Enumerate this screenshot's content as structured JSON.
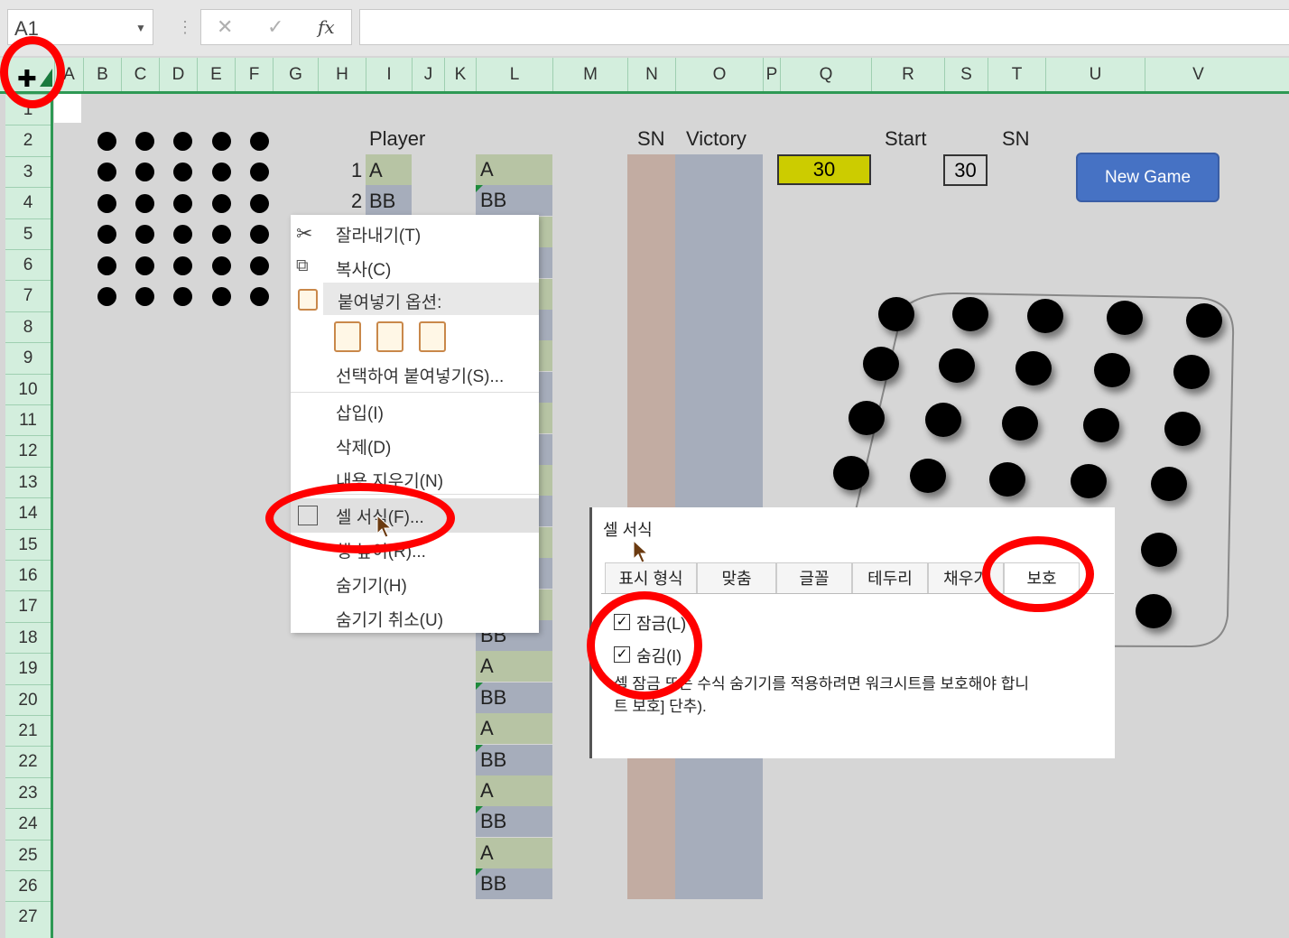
{
  "formula_bar": {
    "name_box": "A1",
    "cancel_icon": "✕",
    "enter_icon": "✓",
    "fx_label": "fx",
    "separator": "⋮"
  },
  "columns": [
    "A",
    "B",
    "C",
    "D",
    "E",
    "F",
    "G",
    "H",
    "I",
    "J",
    "K",
    "L",
    "M",
    "N",
    "O",
    "P",
    "Q",
    "R",
    "S",
    "T",
    "U",
    "V"
  ],
  "rows": [
    "1",
    "2",
    "3",
    "4",
    "5",
    "6",
    "7",
    "8",
    "9",
    "10",
    "11",
    "12",
    "13",
    "14",
    "15",
    "16",
    "17",
    "18",
    "19",
    "20",
    "21",
    "22",
    "23",
    "24",
    "25",
    "26",
    "27"
  ],
  "sheet": {
    "player_header": "Player",
    "players": [
      {
        "num": "1",
        "name": "A"
      },
      {
        "num": "2",
        "name": "BB"
      }
    ],
    "l_column_top": [
      "A",
      "BB"
    ],
    "l_column_bottom": [
      "BB",
      "A",
      "BB",
      "A",
      "BB",
      "A",
      "BB",
      "A",
      "BB"
    ],
    "sn_header": "SN",
    "victory_header": "Victory",
    "start_header": "Start",
    "sn2_header": "SN",
    "q3_value": "30",
    "t3_value": "30",
    "new_game_button": "New Game",
    "colors": {
      "q3_fill": "#cccc00",
      "sn_col": "#c2aca2",
      "victory_col": "#a6adbb",
      "l_green": "#b7c4a4",
      "l_blue": "#a6adbb",
      "button": "#4672c4"
    }
  },
  "context_menu": {
    "cut": "잘라내기(T)",
    "copy": "복사(C)",
    "paste_options": "붙여넣기 옵션:",
    "paste_special": "선택하여 붙여넣기(S)...",
    "insert": "삽입(I)",
    "delete": "삭제(D)",
    "clear": "내용 지우기(N)",
    "format_cells": "셀 서식(F)...",
    "row_height": "행 높이(R)...",
    "hide": "숨기기(H)",
    "unhide": "숨기기 취소(U)"
  },
  "dialog": {
    "title": "셀 서식",
    "tabs": [
      "표시 형식",
      "맞춤",
      "글꼴",
      "테두리",
      "채우기",
      "보호"
    ],
    "active_tab": "보호",
    "locked_label": "잠금(L)",
    "hidden_label": "숨김(I)",
    "locked_checked": true,
    "hidden_checked": true,
    "note": "셀 잠금 또는 수식 숨기기를 적용하려면 워크시트를 보호해야 합니\n트 보호] 단추)."
  }
}
